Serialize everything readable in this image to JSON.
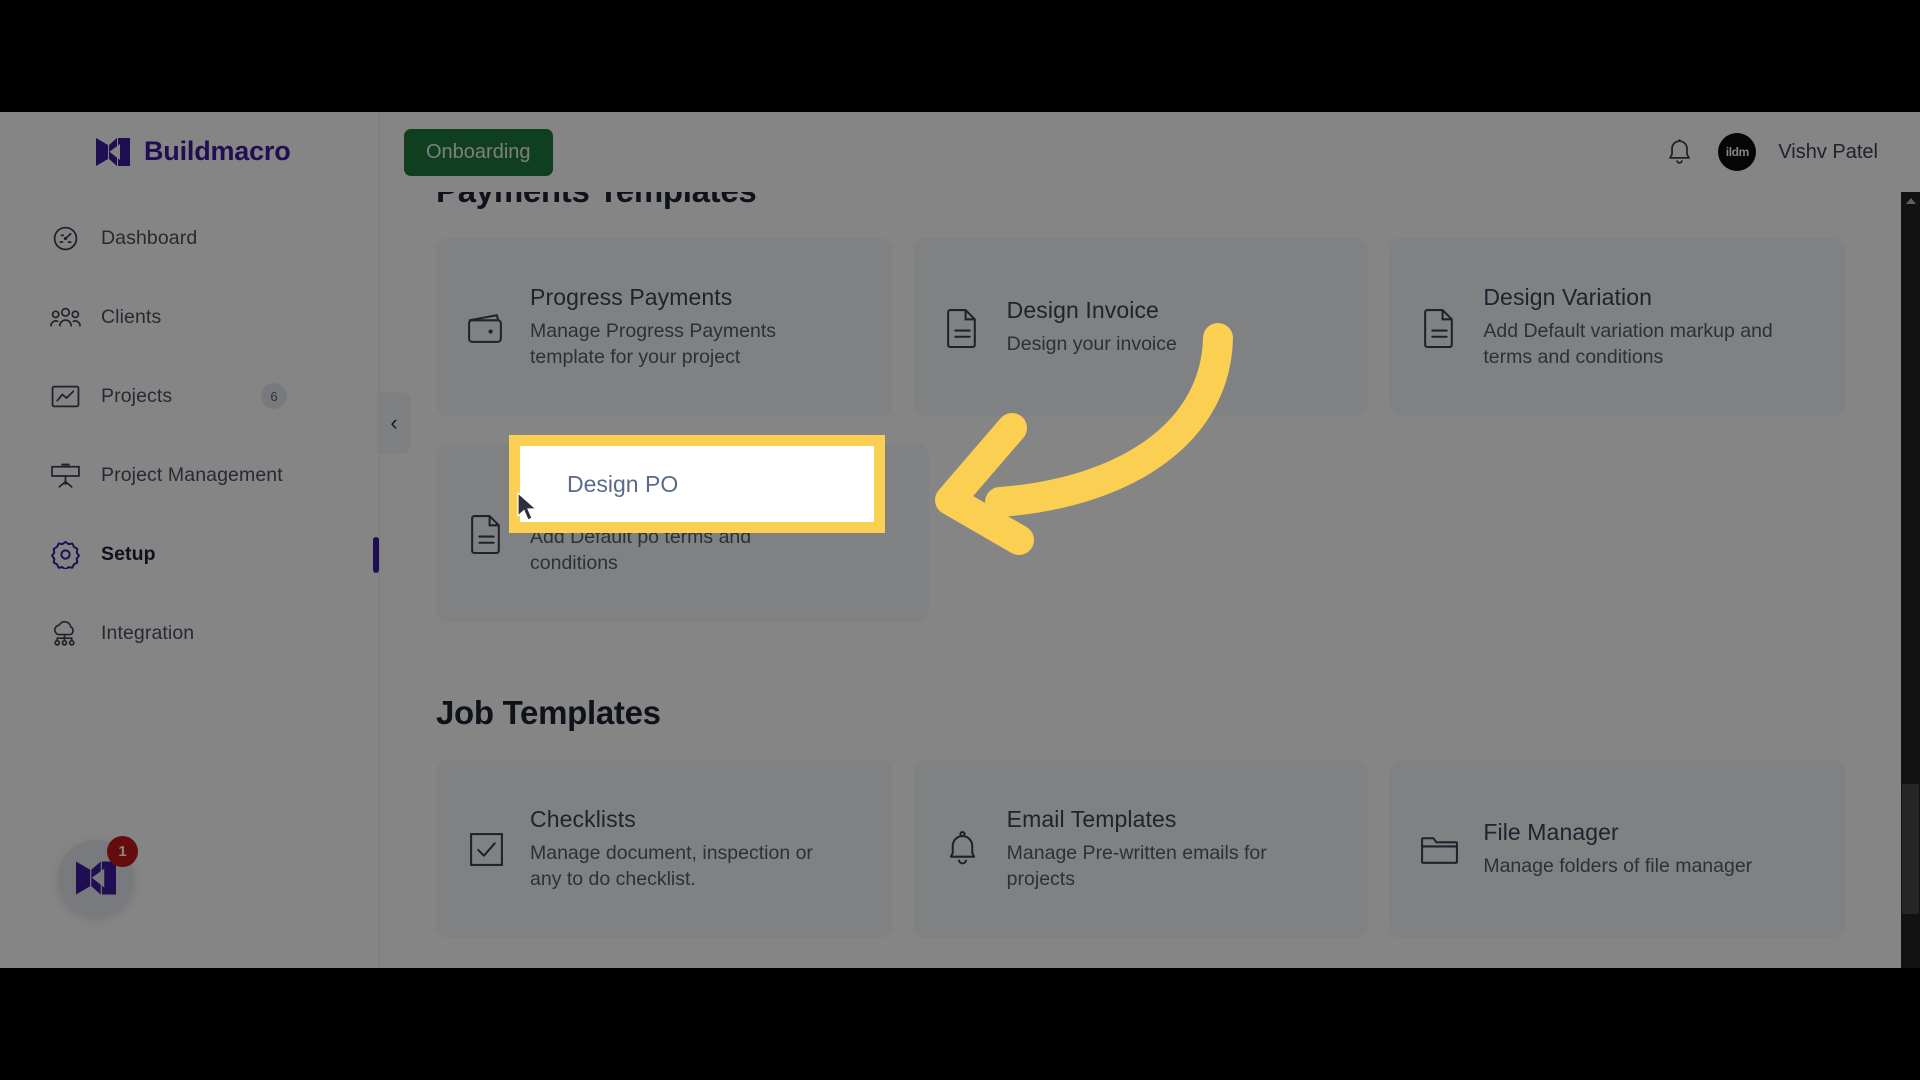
{
  "brand": {
    "name": "Buildmacro",
    "logo_icon": "buildmacro-m-logo"
  },
  "sidebar": {
    "items": [
      {
        "label": "Dashboard",
        "icon": "speedometer-icon",
        "badge": null,
        "active": false
      },
      {
        "label": "Clients",
        "icon": "people-group-icon",
        "badge": null,
        "active": false
      },
      {
        "label": "Projects",
        "icon": "chart-box-icon",
        "badge": "6",
        "active": false
      },
      {
        "label": "Project Management",
        "icon": "presentation-board-icon",
        "badge": null,
        "active": false
      },
      {
        "label": "Setup",
        "icon": "gear-icon",
        "badge": null,
        "active": true
      },
      {
        "label": "Integration",
        "icon": "cloud-network-icon",
        "badge": null,
        "active": false
      }
    ],
    "collapse_icon": "chevron-left-icon",
    "fab": {
      "icon": "buildmacro-m-logo",
      "badge": "1"
    }
  },
  "header": {
    "onboarding_label": "Onboarding",
    "notification_icon": "bell-icon",
    "avatar_text": "ildm",
    "user_name": "Vishv Patel"
  },
  "main": {
    "payments_section_title": "Payments Templates",
    "payments_cards": [
      {
        "title": "Progress Payments",
        "desc": "Manage Progress Payments template for your project",
        "icon": "wallet-icon"
      },
      {
        "title": "Design Invoice",
        "desc": "Design your invoice",
        "icon": "document-lines-icon"
      },
      {
        "title": "Design Variation",
        "desc": "Add Default variation markup and terms and conditions",
        "icon": "document-lines-icon"
      },
      {
        "title": "Design PO",
        "desc": "Add Default po terms and conditions",
        "icon": "document-lines-icon"
      }
    ],
    "job_section_title": "Job Templates",
    "job_cards": [
      {
        "title": "Checklists",
        "desc": "Manage document, inspection or any to do checklist.",
        "icon": "checkbox-check-icon"
      },
      {
        "title": "Email Templates",
        "desc": "Manage Pre-written emails for projects",
        "icon": "bell-icon"
      },
      {
        "title": "File Manager",
        "desc": "Manage folders of file manager",
        "icon": "folder-icon"
      }
    ]
  },
  "annotation": {
    "highlight_target_title": "Design PO",
    "highlight_target_desc": "Add Default po terms and",
    "arrow_icon": "curved-left-arrow-icon",
    "highlight_color": "#fbcf51",
    "cursor_icon": "mouse-pointer-icon"
  },
  "scrollbar": {
    "up_icon": "scroll-up-arrow-icon",
    "down_icon": "scroll-down-arrow-icon",
    "thumb": "scroll-thumb"
  },
  "colors": {
    "brand_purple": "#3d1d9e",
    "onboarding_green": "#1e7a3c",
    "badge_red": "#c11a1a",
    "highlight_yellow": "#fbcf51",
    "card_bg": "#f6f7f9"
  }
}
